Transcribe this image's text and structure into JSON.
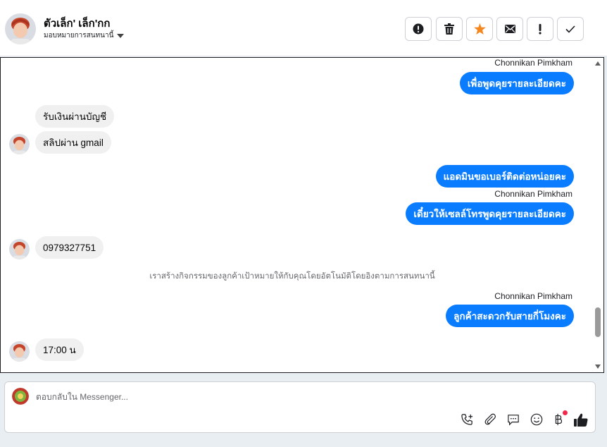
{
  "header": {
    "contact_name": "ตัวเล็ก' เล็ก'กก",
    "assign_label": "มอบหมายการสนทนานี้",
    "actions": [
      {
        "icon": "alert-circle-icon",
        "name": "mark-spam-button"
      },
      {
        "icon": "trash-icon",
        "name": "delete-button"
      },
      {
        "icon": "star-icon",
        "name": "star-button"
      },
      {
        "icon": "envelope-icon",
        "name": "mark-unread-button"
      },
      {
        "icon": "exclamation-icon",
        "name": "follow-up-button"
      },
      {
        "icon": "check-icon",
        "name": "mark-done-button"
      }
    ],
    "star_color": "#f5871f"
  },
  "messages": {
    "sender_name": "Chonnikan Pimkham",
    "m1": "เพื่อพูดคุยรายละเอียดคะ",
    "m2": "รับเงินผ่านบัญชี",
    "m3": "สลิปผ่าน gmail",
    "m4": "แอดมินขอเบอร์ติดต่อหน่อยคะ",
    "m5": "เดี๋ยวให้เซลล์โทรพูดคุยรายละเอียดคะ",
    "m6": "0979327751",
    "system_note": "เราสร้างกิจกรรมของลูกค้าเป้าหมายให้กับคุณโดยอัตโนมัติโดยอิงตามการสนทนานี้",
    "m7": "ลูกค้าสะดวกรับสายกี่โมงคะ",
    "m8": "17:00 น"
  },
  "composer": {
    "placeholder": "ตอบกลับใน Messenger...",
    "icons": [
      "add-call-icon",
      "paperclip-icon",
      "saved-reply-icon",
      "emoji-icon",
      "baht-payment-icon",
      "thumbs-up-icon"
    ]
  },
  "colors": {
    "outgoing_bubble": "#0a7cff",
    "incoming_bubble": "#f0f0f0",
    "badge_dot": "#f02849"
  }
}
